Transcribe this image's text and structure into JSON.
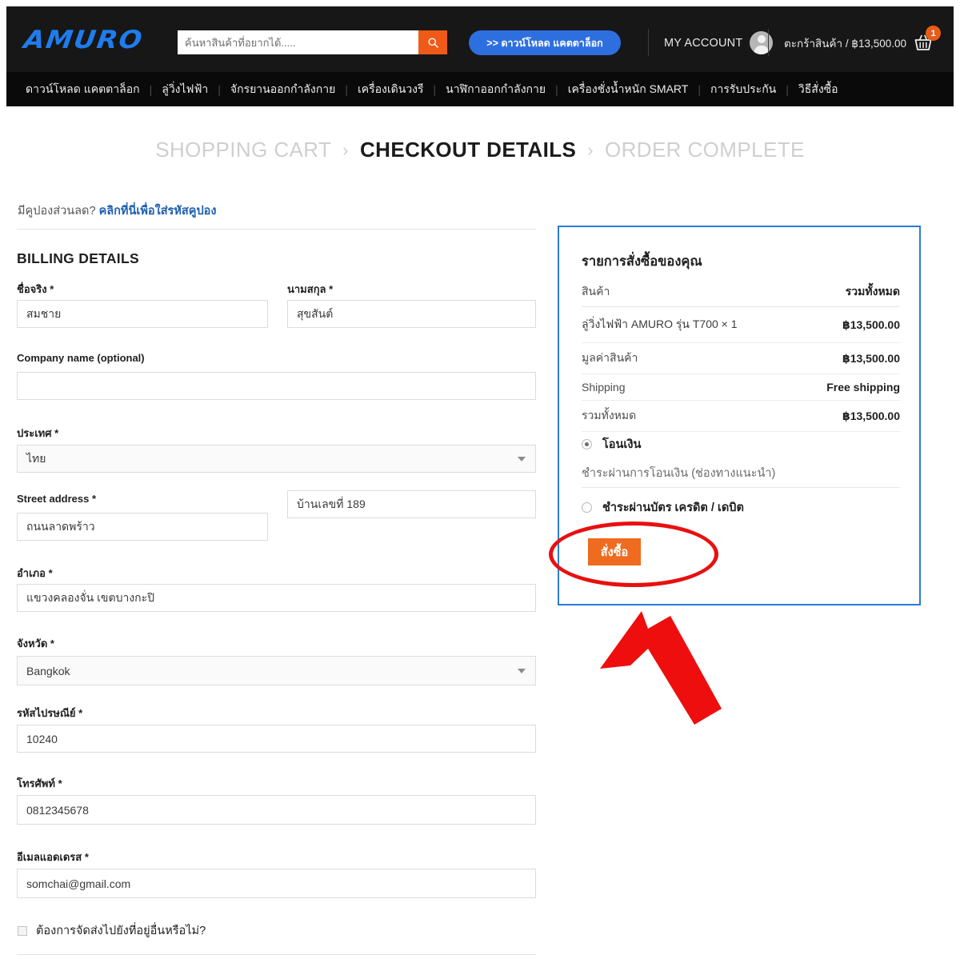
{
  "header": {
    "logo": "AMURO",
    "search": {
      "placeholder": "ค้นหาสินค้าที่อยากได้.....",
      "value": "",
      "icon": "search-icon"
    },
    "catalog_button": ">> ดาวน์โหลด แคตตาล็อก",
    "account_label": "MY ACCOUNT",
    "cart_text": "ตะกร้าสินค้า / ฿13,500.00",
    "cart_badge": "1"
  },
  "nav": {
    "items": [
      "ดาวน์โหลด แคตตาล็อก",
      "ลู่วิ่งไฟฟ้า",
      "จักรยานออกกำลังกาย",
      "เครื่องเดินวงรี",
      "นาฬิกาออกกำลังกาย",
      "เครื่องชั่งน้ำหนัก SMART",
      "การรับประกัน",
      "วิธีสั่งซื้อ"
    ]
  },
  "steps": [
    {
      "label": "SHOPPING CART",
      "active": false
    },
    {
      "label": "CHECKOUT DETAILS",
      "active": true
    },
    {
      "label": "ORDER COMPLETE",
      "active": false
    }
  ],
  "coupon": {
    "prefix": "มีคูปองส่วนลด? ",
    "link": "คลิกที่นี่เพื่อใส่รหัสคูปอง"
  },
  "billing": {
    "title": "BILLING DETAILS",
    "first_name": {
      "label": "ชื่อจริง",
      "required": "*",
      "value": "สมชาย"
    },
    "last_name": {
      "label": "นามสกุล",
      "required": "*",
      "value": "สุขสันต์"
    },
    "company": {
      "label": "Company name (optional)",
      "value": ""
    },
    "country": {
      "label": "ประเทศ",
      "required": "*",
      "value": "ไทย"
    },
    "street": {
      "label": "Street address",
      "required": "*",
      "value": "ถนนลาดพร้าว"
    },
    "street2": {
      "value": "บ้านเลขที่ 189"
    },
    "district": {
      "label": "อำเภอ",
      "required": "*",
      "value": "แขวงคลองจั่น เขตบางกะปิ"
    },
    "province": {
      "label": "จังหวัด",
      "required": "*",
      "value": "Bangkok"
    },
    "postcode": {
      "label": "รหัสไปรษณีย์",
      "required": "*",
      "value": "10240"
    },
    "phone": {
      "label": "โทรศัพท์",
      "required": "*",
      "value": "0812345678"
    },
    "email": {
      "label": "อีเมลแอดเดรส",
      "required": "*",
      "value": "somchai@gmail.com"
    },
    "ship_elsewhere": {
      "label": "ต้องการจัดส่งไปยังที่อยู่อื่นหรือไม่?",
      "checked": false
    }
  },
  "order": {
    "title": "รายการสั่งซื้อของคุณ",
    "col_product": "สินค้า",
    "col_total": "รวมทั้งหมด",
    "lines": [
      {
        "name": "ลู่วิ่งไฟฟ้า AMURO รุ่น T700  × 1",
        "amount": "฿13,500.00"
      },
      {
        "name": "มูลค่าสินค้า",
        "amount": "฿13,500.00"
      },
      {
        "name": "Shipping",
        "amount": "Free shipping"
      },
      {
        "name": "รวมทั้งหมด",
        "amount": "฿13,500.00"
      }
    ],
    "payments": [
      {
        "label": "โอนเงิน",
        "selected": true
      },
      {
        "label": "ชำระผ่านบัตร เครดิต / เดบิต",
        "selected": false
      }
    ],
    "payment_desc": "ชำระผ่านการโอนเงิน (ช่องทางแนะนำ)",
    "place_order": "สั่งซื้อ"
  },
  "colors": {
    "header_bg": "#171717",
    "nav_bg": "#0a0a0a",
    "logo_blue": "#1f7ced",
    "accent_orange": "#ef5a18",
    "button_blue": "#2e6fe0",
    "panel_border": "#2b7cd3",
    "annotation_red": "#e81010",
    "order_button": "#ee6b1f"
  }
}
